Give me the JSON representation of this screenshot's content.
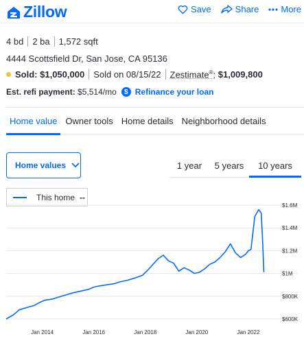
{
  "header": {
    "logo_text": "Zillow",
    "save_label": "Save",
    "share_label": "Share",
    "more_label": "More",
    "brand_color": "#006aff"
  },
  "property": {
    "beds": "4 bd",
    "baths": "2 ba",
    "sqft": "1,572 sqft",
    "address": "4444 Scottsfield Dr, San Jose, CA 95136",
    "sold_label": "Sold:",
    "sold_price": "$1,050,000",
    "sold_date": "Sold on 08/15/22",
    "zestimate_label": "Zestimate",
    "zestimate_sup": "®",
    "zestimate_value": "$1,009,800",
    "refi_label": "Est. refi payment:",
    "refi_value": "$5,514/mo",
    "refi_icon": "$",
    "refi_link": "Refinance your loan"
  },
  "tabs": [
    {
      "label": "Home value",
      "active": true
    },
    {
      "label": "Owner tools",
      "active": false
    },
    {
      "label": "Home details",
      "active": false
    },
    {
      "label": "Neighborhood details",
      "active": false
    }
  ],
  "controls": {
    "dropdown_label": "Home values",
    "ranges": [
      {
        "label": "1 year",
        "active": false
      },
      {
        "label": "5 years",
        "active": false
      },
      {
        "label": "10 years",
        "active": true
      }
    ],
    "legend_label": "This home",
    "legend_value": "--"
  },
  "chart_data": {
    "type": "line",
    "title": "",
    "xlabel": "",
    "ylabel": "",
    "x_ticks": [
      "Jan 2014",
      "Jan 2016",
      "Jan 2018",
      "Jan 2020",
      "Jan 2022"
    ],
    "y_ticks": [
      "$600K",
      "$800K",
      "$1M",
      "$1.2M",
      "$1.4M",
      "$1.6M"
    ],
    "ylim": [
      600000,
      1600000
    ],
    "xlim": [
      2012.6,
      2022.8
    ],
    "grid": "horizontal",
    "series": [
      {
        "name": "This home",
        "color": "#006aff",
        "x": [
          2012.6,
          2012.9,
          2013.1,
          2013.4,
          2013.7,
          2013.9,
          2014.1,
          2014.4,
          2014.6,
          2014.9,
          2015.2,
          2015.5,
          2015.8,
          2016.0,
          2016.2,
          2016.5,
          2016.8,
          2017.0,
          2017.3,
          2017.6,
          2017.9,
          2018.1,
          2018.3,
          2018.5,
          2018.7,
          2018.9,
          2019.1,
          2019.3,
          2019.5,
          2019.7,
          2019.9,
          2020.1,
          2020.3,
          2020.5,
          2020.7,
          2020.9,
          2021.1,
          2021.3,
          2021.5,
          2021.7,
          2021.9,
          2022.0,
          2022.1,
          2022.25,
          2022.4,
          2022.5,
          2022.55,
          2022.6
        ],
        "values": [
          600000,
          640000,
          680000,
          700000,
          720000,
          745000,
          765000,
          775000,
          790000,
          810000,
          830000,
          845000,
          860000,
          880000,
          890000,
          900000,
          910000,
          925000,
          940000,
          960000,
          985000,
          1030000,
          1080000,
          1130000,
          1160000,
          1110000,
          1090000,
          1020000,
          1050000,
          1030000,
          1000000,
          1010000,
          1040000,
          1080000,
          1100000,
          1140000,
          1190000,
          1260000,
          1180000,
          1140000,
          1170000,
          1200000,
          1210000,
          1500000,
          1560000,
          1530000,
          1300000,
          1010000
        ]
      }
    ]
  }
}
